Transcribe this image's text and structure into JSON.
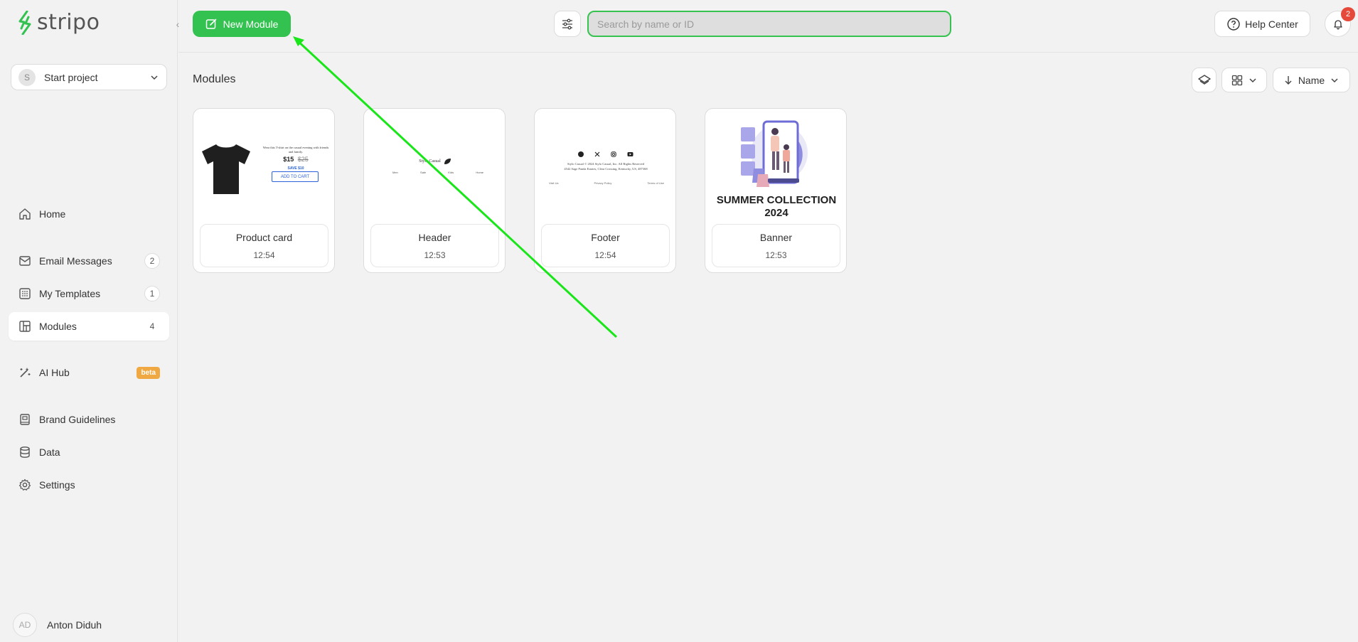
{
  "brand": {
    "name": "stripo",
    "accent": "#33c24f"
  },
  "project": {
    "avatar": "S",
    "label": "Start project"
  },
  "nav": [
    {
      "label": "Home",
      "icon": "home-icon",
      "count": null
    },
    {
      "label": "Email Messages",
      "icon": "mail-icon",
      "count": "2"
    },
    {
      "label": "My Templates",
      "icon": "templates-icon",
      "count": "1"
    },
    {
      "label": "Modules",
      "icon": "modules-icon",
      "count": "4",
      "active": true
    },
    {
      "label": "AI Hub",
      "icon": "magic-wand-icon",
      "badge": "beta"
    },
    {
      "label": "Brand Guidelines",
      "icon": "book-icon"
    },
    {
      "label": "Data",
      "icon": "database-icon"
    },
    {
      "label": "Settings",
      "icon": "gear-icon"
    }
  ],
  "user": {
    "initials": "AD",
    "name": "Anton Diduh"
  },
  "topbar": {
    "new_module_label": "New Module",
    "search_placeholder": "Search by name or ID",
    "help_label": "Help Center",
    "notifications_count": "2"
  },
  "content": {
    "title": "Modules",
    "sort_label": "Name"
  },
  "modules": [
    {
      "name": "Product card",
      "time": "12:54",
      "preview": {
        "blurb": "Wear this T-shirt on the casual evening with friends and family.",
        "price": "$15",
        "old_price": "$25",
        "save": "SAVE $10",
        "cta": "ADD TO CART"
      }
    },
    {
      "name": "Header",
      "time": "12:53",
      "preview": {
        "logo_text": "Stylo Casual",
        "menu": [
          "Men",
          "Sale",
          "Kids",
          "Home"
        ]
      }
    },
    {
      "name": "Footer",
      "time": "12:54",
      "preview": {
        "line1": "Stylo Casual © 2024 Stylo Casual, Inc. All Rights Reserved",
        "line2": "4542 Sage Panda Estates, Clear Crossing, Kentucky, US, 487368",
        "links": [
          "Visit Us",
          "Privacy Policy",
          "Terms of Use"
        ]
      }
    },
    {
      "name": "Banner",
      "time": "12:53",
      "preview": {
        "headline": "SUMMER COLLECTION 2024"
      }
    }
  ]
}
